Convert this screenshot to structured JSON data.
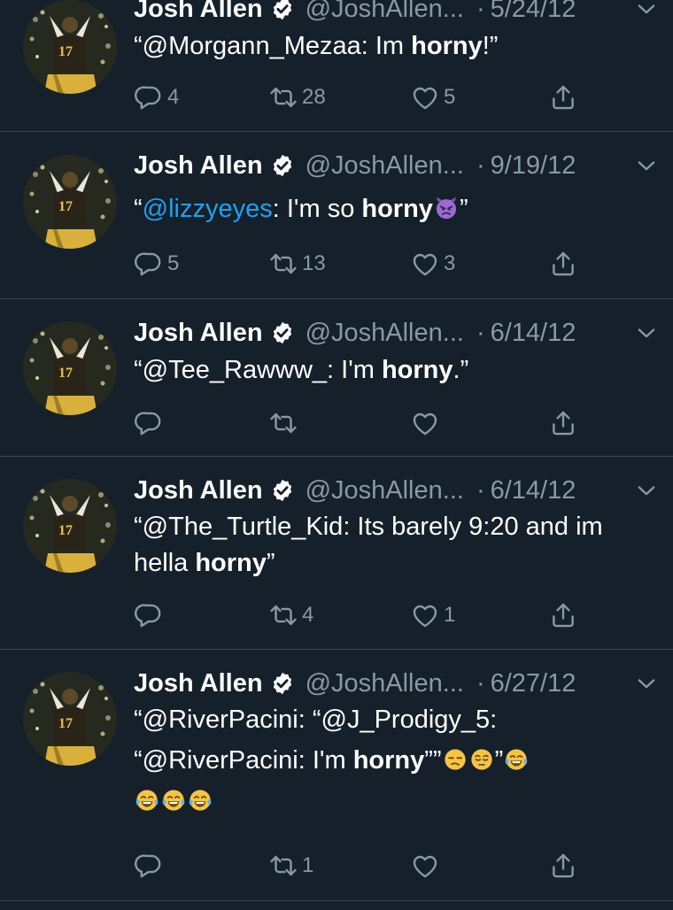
{
  "tweets": [
    {
      "name": "Josh Allen",
      "handle": "@JoshAllen...",
      "dot": "·",
      "date": "5/24/12",
      "text": {
        "q1": "“",
        "mention": "@Morgann_Mezaa",
        "pre": ": Im ",
        "bold": "horny",
        "post": "!”"
      },
      "replies": "4",
      "retweets": "28",
      "likes": "5"
    },
    {
      "name": "Josh Allen",
      "handle": "@JoshAllen...",
      "dot": "·",
      "date": "9/19/12",
      "text": {
        "q1": "“",
        "mention": "@lizzyeyes",
        "pre": ": I'm so ",
        "bold": "horny",
        "post": "”"
      },
      "emoji": "angry-devil-emoji",
      "replies": "5",
      "retweets": "13",
      "likes": "3"
    },
    {
      "name": "Josh Allen",
      "handle": "@JoshAllen...",
      "dot": "·",
      "date": "6/14/12",
      "text": {
        "q1": "“",
        "mention": "@Tee_Rawww_",
        "pre": ": I'm ",
        "bold": "horny",
        "post": ".”"
      },
      "replies": "",
      "retweets": "",
      "likes": ""
    },
    {
      "name": "Josh Allen",
      "handle": "@JoshAllen...",
      "dot": "·",
      "date": "6/14/12",
      "text": {
        "q1": "“",
        "mention": "@The_Turtle_Kid",
        "pre": ": Its barely 9:20 and im hella ",
        "bold": "horny",
        "post": "”"
      },
      "replies": "",
      "retweets": "4",
      "likes": "1"
    },
    {
      "name": "Josh Allen",
      "handle": "@JoshAllen...",
      "dot": "·",
      "date": "6/27/12",
      "text": {
        "line1": "“@RiverPacini: “@J_Prodigy_5:",
        "pre": "“@RiverPacini: I'm ",
        "bold": "horny",
        "post": "””",
        "post2": "”"
      },
      "emojis": [
        "unamused-face-emoji",
        "pensive-face-emoji",
        "tears-of-joy-emoji",
        "tears-of-joy-emoji",
        "tears-of-joy-emoji",
        "tears-of-joy-emoji"
      ],
      "replies": "",
      "retweets": "1",
      "likes": ""
    }
  ],
  "colors": {
    "background": "#15202b",
    "divider": "#38444d",
    "secondary_text": "#8899a6",
    "mention": "#1da1f2"
  },
  "icons": [
    "verified-badge-icon",
    "chevron-down-icon",
    "reply-icon",
    "retweet-icon",
    "like-icon",
    "share-icon"
  ]
}
